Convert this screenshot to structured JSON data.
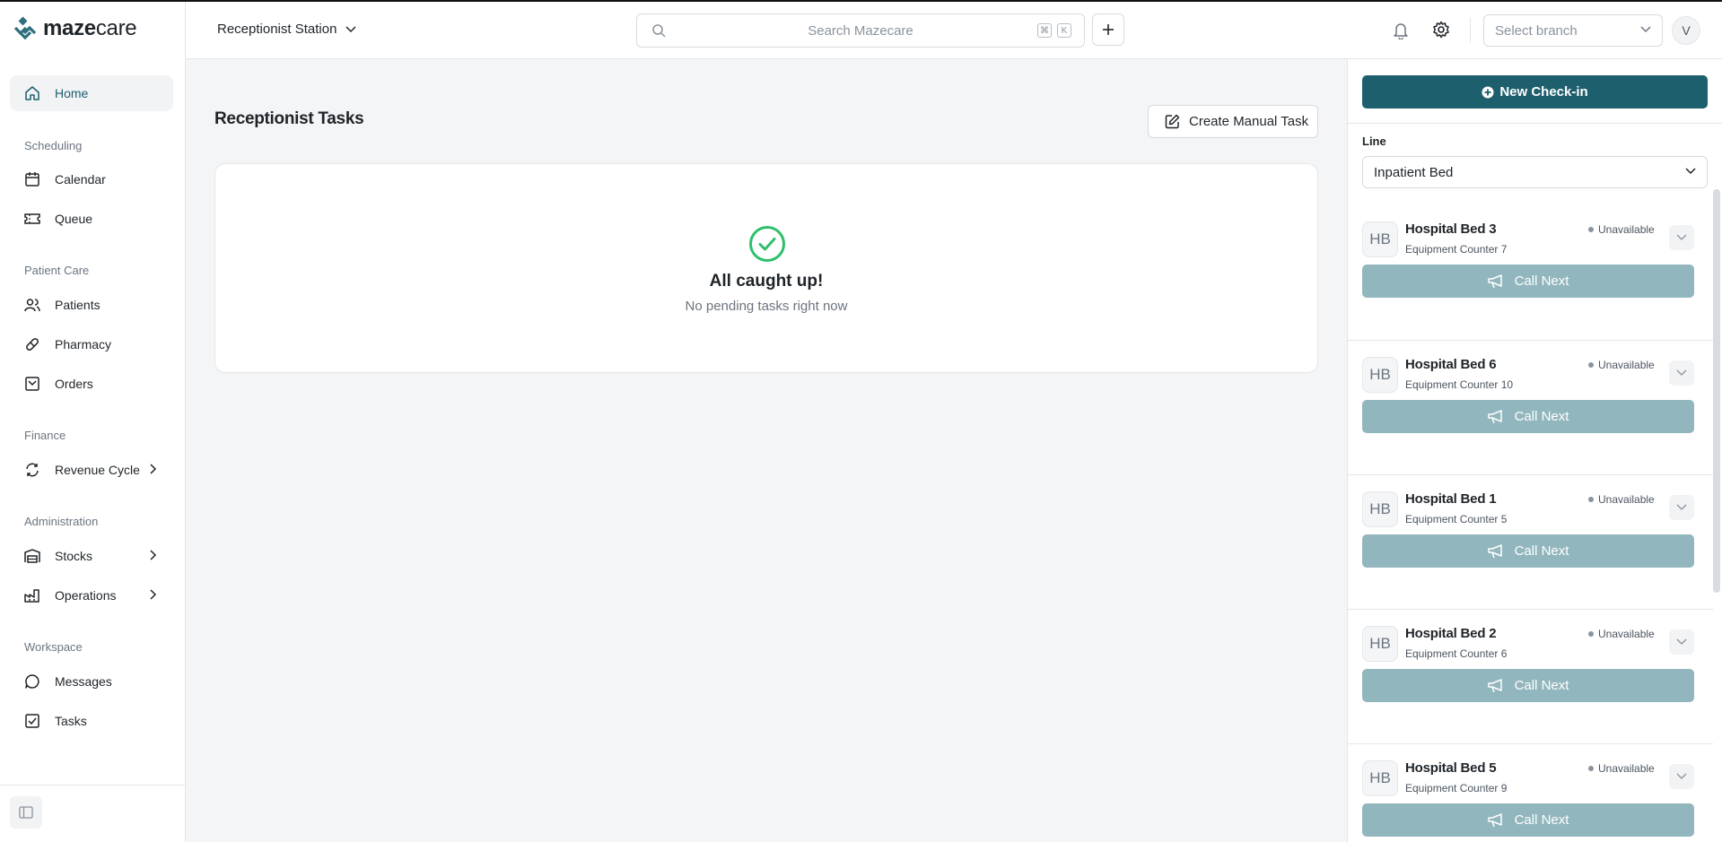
{
  "app": {
    "logo_text_bold": "maze",
    "logo_text_light": "care"
  },
  "sidebar": {
    "home": "Home",
    "sections": {
      "scheduling": "Scheduling",
      "patient_care": "Patient Care",
      "finance": "Finance",
      "administration": "Administration",
      "workspace": "Workspace"
    },
    "items": {
      "calendar": "Calendar",
      "queue": "Queue",
      "patients": "Patients",
      "pharmacy": "Pharmacy",
      "orders": "Orders",
      "revenue_cycle": "Revenue Cycle",
      "stocks": "Stocks",
      "operations": "Operations",
      "messages": "Messages",
      "tasks": "Tasks"
    }
  },
  "header": {
    "station": "Receptionist Station",
    "search_placeholder": "Search Mazecare",
    "kbd_mod": "⌘",
    "kbd_key": "K",
    "branch_placeholder": "Select branch",
    "avatar_initial": "V"
  },
  "main": {
    "title": "Receptionist Tasks",
    "create_button": "Create Manual Task",
    "empty_title": "All caught up!",
    "empty_subtitle": "No pending tasks right now"
  },
  "panel": {
    "checkin_button": "New Check-in",
    "line_label": "Line",
    "line_value": "Inpatient Bed",
    "call_label": "Call Next",
    "resources": [
      {
        "initials": "HB",
        "name": "Hospital Bed 3",
        "counter": "Equipment Counter 7",
        "status": "Unavailable"
      },
      {
        "initials": "HB",
        "name": "Hospital Bed 6",
        "counter": "Equipment Counter 10",
        "status": "Unavailable"
      },
      {
        "initials": "HB",
        "name": "Hospital Bed 1",
        "counter": "Equipment Counter 5",
        "status": "Unavailable"
      },
      {
        "initials": "HB",
        "name": "Hospital Bed 2",
        "counter": "Equipment Counter 6",
        "status": "Unavailable"
      },
      {
        "initials": "HB",
        "name": "Hospital Bed 5",
        "counter": "Equipment Counter 9",
        "status": "Unavailable"
      }
    ]
  },
  "colors": {
    "brand_teal": "#1e5f6e",
    "call_button_disabled": "#92b6bd",
    "success_green": "#2fbf6b"
  }
}
